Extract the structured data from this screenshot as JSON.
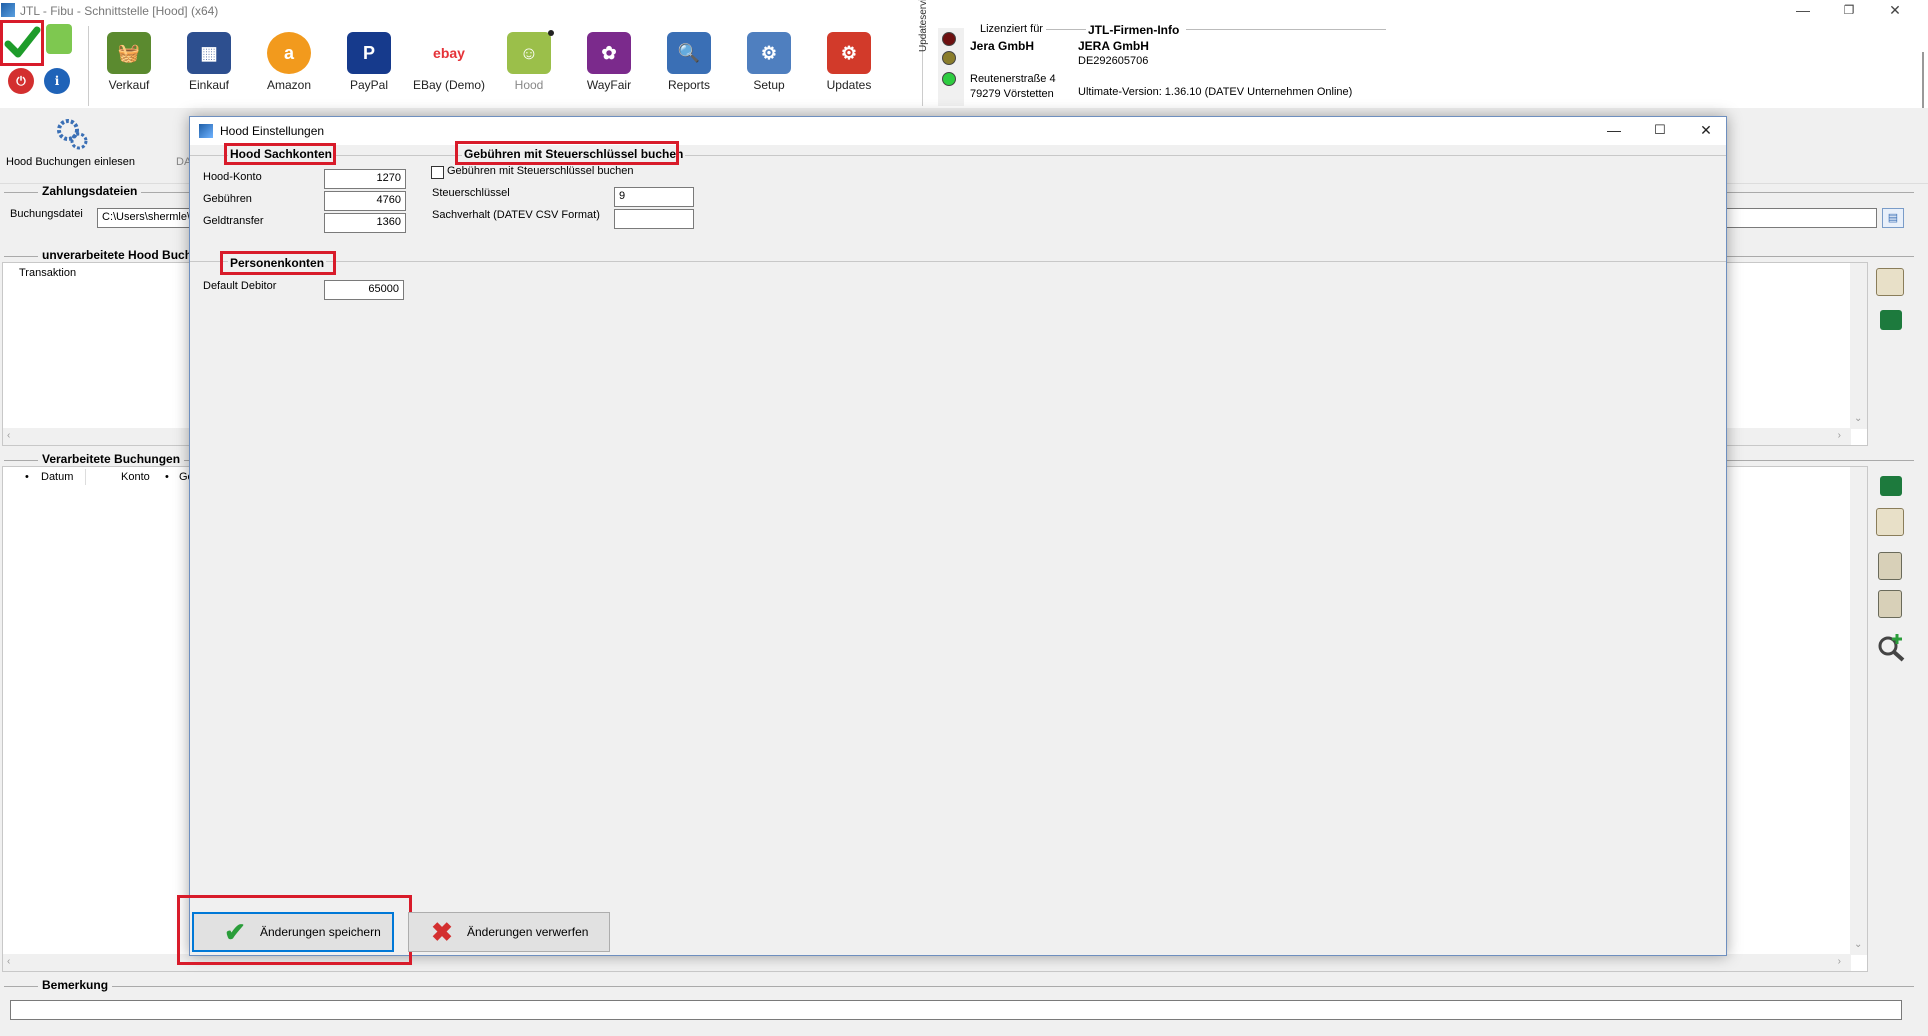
{
  "window": {
    "title": "JTL - Fibu - Schnittstelle [Hood] (x64)",
    "controls": {
      "minimize": "—",
      "maximize": "❐",
      "close": "✕"
    }
  },
  "ribbon": {
    "items": [
      {
        "label": "Verkauf",
        "icon": "basket-icon",
        "color": "#5b8a2f"
      },
      {
        "label": "Einkauf",
        "icon": "blocks-icon",
        "color": "#2d4f8f"
      },
      {
        "label": "Amazon",
        "icon": "amazon-icon",
        "color": "#f29a1d"
      },
      {
        "label": "PayPal",
        "icon": "paypal-icon",
        "color": "#163a8c"
      },
      {
        "label": "EBay (Demo)",
        "icon": "ebay-icon",
        "color": "#e53238"
      },
      {
        "label": "Hood",
        "icon": "hood-icon",
        "color": "#9bbf4a"
      },
      {
        "label": "WayFair",
        "icon": "wayfair-icon",
        "color": "#7b2a8c"
      },
      {
        "label": "Reports",
        "icon": "reports-icon",
        "color": "#3a6fb5"
      },
      {
        "label": "Setup",
        "icon": "setup-icon",
        "color": "#4f7fbf"
      },
      {
        "label": "Updates",
        "icon": "updates-icon",
        "color": "#d23a2a"
      }
    ],
    "updateservice_label": "Updateservice",
    "license": {
      "header": "Lizenziert für",
      "company": "Jera GmbH",
      "street": "Reutenerstraße 4",
      "city": "79279 Vörstetten"
    },
    "firm_info": {
      "header": "JTL-Firmen-Info",
      "company": "JERA GmbH",
      "vat_id": "DE292605706",
      "version": "Ultimate-Version: 1.36.10 (DATEV Unternehmen Online)"
    },
    "status_colors": [
      "#6e1111",
      "#8a7d2b",
      "#2ecc40"
    ]
  },
  "toolbar2": {
    "read_button": "Hood Buchungen einlesen",
    "truncated": "DA"
  },
  "main": {
    "zahlungsdateien": "Zahlungsdateien",
    "buchungsdatei_label": "Buchungsdatei",
    "buchungsdatei_value": "C:\\Users\\shermle\\",
    "unprocessed_header": "unverarbeitete Hood Buch",
    "transaktion_col": "Transaktion",
    "processed_header": "Verarbeitete Buchungen",
    "processed_cols": [
      "Datum",
      "Konto",
      "Ge"
    ],
    "bemerkung": "Bemerkung"
  },
  "dialog": {
    "title": "Hood Einstellungen",
    "sachkonten": {
      "title": "Hood Sachkonten",
      "fields": [
        {
          "label": "Hood-Konto",
          "value": "1270"
        },
        {
          "label": "Gebühren",
          "value": "4760"
        },
        {
          "label": "Geldtransfer",
          "value": "1360"
        }
      ]
    },
    "gebuehren": {
      "title": "Gebühren mit Steuerschlüssel buchen",
      "checkbox_label": "Gebühren mit Steuerschlüssel buchen",
      "checked": false,
      "steuerschluessel_label": "Steuerschlüssel",
      "steuerschluessel_value": "9",
      "sachverhalt_label": "Sachverhalt (DATEV CSV Format)",
      "sachverhalt_value": ""
    },
    "personenkonten": {
      "title": "Personenkonten",
      "default_debitor_label": "Default Debitor",
      "default_debitor_value": "65000"
    },
    "save_button": "Änderungen speichern",
    "discard_button": "Änderungen verwerfen",
    "highlight_color": "#d81b2a"
  }
}
